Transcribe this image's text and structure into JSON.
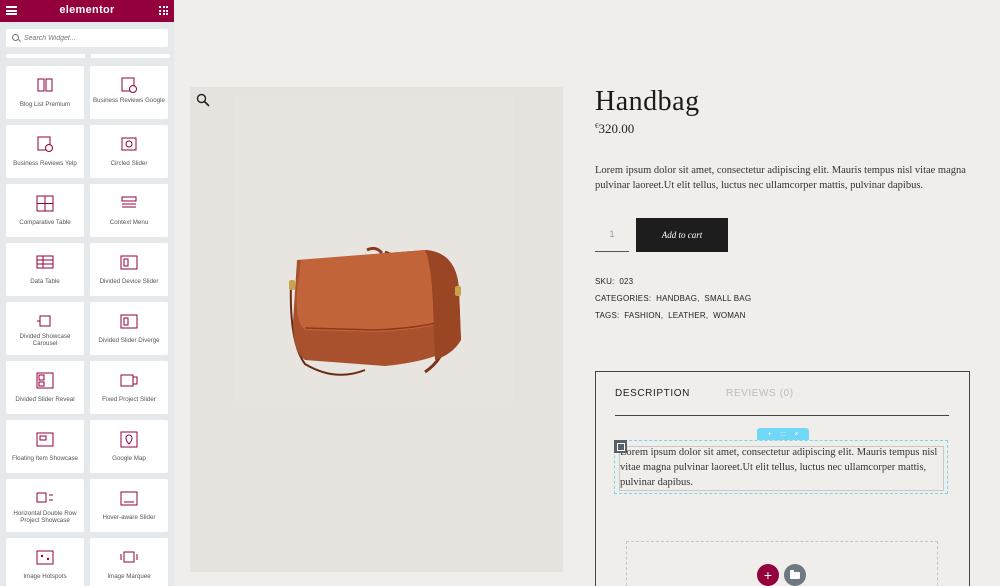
{
  "app": {
    "logo": "elementor"
  },
  "search": {
    "placeholder": "Search Widget..."
  },
  "widgets": [
    {
      "label": "Blog List Premium",
      "icon": "blog-list-icon"
    },
    {
      "label": "Business Reviews Google",
      "icon": "business-reviews-google-icon"
    },
    {
      "label": "Business Reviews Yelp",
      "icon": "business-reviews-yelp-icon"
    },
    {
      "label": "Circled Slider",
      "icon": "circled-slider-icon"
    },
    {
      "label": "Comparative Table",
      "icon": "comparative-table-icon"
    },
    {
      "label": "Context Menu",
      "icon": "context-menu-icon"
    },
    {
      "label": "Data Table",
      "icon": "data-table-icon"
    },
    {
      "label": "Divided Device Slider",
      "icon": "divided-device-slider-icon"
    },
    {
      "label": "Divided Showcase Carousel",
      "icon": "divided-showcase-carousel-icon"
    },
    {
      "label": "Divided Slider Diverge",
      "icon": "divided-slider-diverge-icon"
    },
    {
      "label": "Divided Slider Reveal",
      "icon": "divided-slider-reveal-icon"
    },
    {
      "label": "Fixed Project Slider",
      "icon": "fixed-project-slider-icon"
    },
    {
      "label": "Floating Item Showcase",
      "icon": "floating-item-showcase-icon"
    },
    {
      "label": "Google Map",
      "icon": "google-map-icon"
    },
    {
      "label": "Horizontal Double Row Project Showcase",
      "icon": "horizontal-double-row-icon"
    },
    {
      "label": "Hover-aware Slider",
      "icon": "hover-aware-slider-icon"
    },
    {
      "label": "Image Hotspots",
      "icon": "image-hotspots-icon"
    },
    {
      "label": "Image Marquee",
      "icon": "image-marquee-icon"
    }
  ],
  "product": {
    "title": "Handbag",
    "currency": "€",
    "price": "320.00",
    "short_description": "Lorem ipsum dolor sit amet, consectetur adipiscing elit. Mauris tempus nisl vitae magna pulvinar laoreet.Ut elit tellus, luctus nec ullamcorper mattis, pulvinar dapibus.",
    "quantity": "1",
    "add_to_cart": "Add to cart",
    "sku_label": "SKU:",
    "sku": "023",
    "categories_label": "CATEGORIES:",
    "categories": [
      "HANDBAG",
      "SMALL BAG"
    ],
    "tags_label": "TAGS:",
    "tags": [
      "FASHION",
      "LEATHER",
      "WOMAN"
    ]
  },
  "tabs": {
    "description": "DESCRIPTION",
    "reviews": "REVIEWS (0)"
  },
  "editor": {
    "text": "Lorem ipsum dolor sit amet, consectetur adipiscing elit. Mauris tempus nisl vitae magna pulvinar laoreet.Ut elit tellus, luctus nec ullamcorper mattis, pulvinar dapibus.",
    "handle_add": "+",
    "handle_drag": ":::",
    "handle_close": "×",
    "add_section": "+"
  },
  "colors": {
    "brand": "#93003c",
    "editor_accent": "#71d7f7",
    "button_dark": "#1d1d1d",
    "bag": "#b5562f"
  }
}
